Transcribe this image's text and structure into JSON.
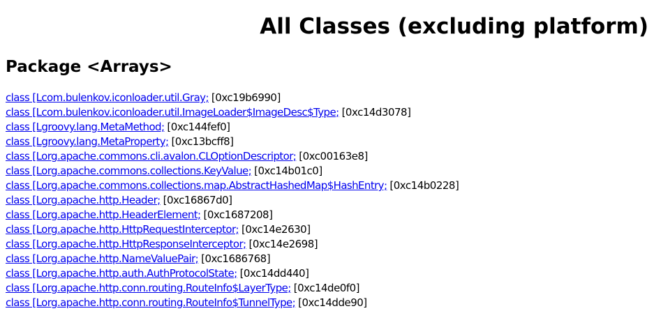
{
  "page": {
    "title": "All Classes (excluding platform)",
    "package_heading": "Package <Arrays>"
  },
  "classes": [
    {
      "link": "class [Lcom.bulenkov.iconloader.util.Gray;",
      "address": "[0xc19b6990]"
    },
    {
      "link": "class [Lcom.bulenkov.iconloader.util.ImageLoader$ImageDesc$Type;",
      "address": "[0xc14d3078]"
    },
    {
      "link": "class [Lgroovy.lang.MetaMethod;",
      "address": "[0xc144fef0]"
    },
    {
      "link": "class [Lgroovy.lang.MetaProperty;",
      "address": "[0xc13bcff8]"
    },
    {
      "link": "class [Lorg.apache.commons.cli.avalon.CLOptionDescriptor;",
      "address": "[0xc00163e8]"
    },
    {
      "link": "class [Lorg.apache.commons.collections.KeyValue;",
      "address": "[0xc14b01c0]"
    },
    {
      "link": "class [Lorg.apache.commons.collections.map.AbstractHashedMap$HashEntry;",
      "address": "[0xc14b0228]"
    },
    {
      "link": "class [Lorg.apache.http.Header;",
      "address": "[0xc16867d0]"
    },
    {
      "link": "class [Lorg.apache.http.HeaderElement;",
      "address": "[0xc1687208]"
    },
    {
      "link": "class [Lorg.apache.http.HttpRequestInterceptor;",
      "address": "[0xc14e2630]"
    },
    {
      "link": "class [Lorg.apache.http.HttpResponseInterceptor;",
      "address": "[0xc14e2698]"
    },
    {
      "link": "class [Lorg.apache.http.NameValuePair;",
      "address": "[0xc1686768]"
    },
    {
      "link": "class [Lorg.apache.http.auth.AuthProtocolState;",
      "address": "[0xc14dd440]"
    },
    {
      "link": "class [Lorg.apache.http.conn.routing.RouteInfo$LayerType;",
      "address": "[0xc14de0f0]"
    },
    {
      "link": "class [Lorg.apache.http.conn.routing.RouteInfo$TunnelType;",
      "address": "[0xc14dde90]"
    }
  ]
}
